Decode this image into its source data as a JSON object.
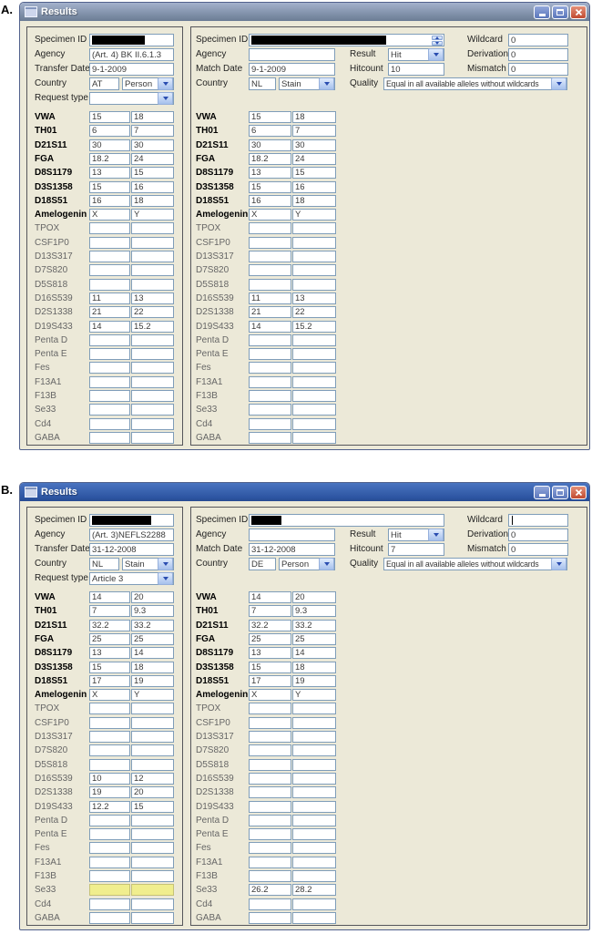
{
  "colors": {
    "titlebar_a": "#76879f",
    "titlebar_b": "#2d55a2",
    "close_button_red": "#c14a31",
    "dialog_background": "#ece9d8",
    "field_border": "#7f9db9",
    "highlight_yellow": "#f0ee8e",
    "redaction_black": "#000000"
  },
  "windows": [
    {
      "figure_label": "A.",
      "title": "Results",
      "left": {
        "specimen_label": "Specimen ID",
        "agency_label": "Agency",
        "agency_value": "(Art. 4) BK II.6.1.3",
        "transfer_label": "Transfer Date",
        "transfer_value": "9-1-2009",
        "country_label": "Country",
        "country_code": "AT",
        "country_type": "Person",
        "request_label": "Request type",
        "request_value": "",
        "loci": [
          {
            "n": "VWA",
            "a": "15",
            "b": "18",
            "bold": true
          },
          {
            "n": "TH01",
            "a": "6",
            "b": "7",
            "bold": true
          },
          {
            "n": "D21S11",
            "a": "30",
            "b": "30",
            "bold": true
          },
          {
            "n": "FGA",
            "a": "18.2",
            "b": "24",
            "bold": true
          },
          {
            "n": "D8S1179",
            "a": "13",
            "b": "15",
            "bold": true
          },
          {
            "n": "D3S1358",
            "a": "15",
            "b": "16",
            "bold": true
          },
          {
            "n": "D18S51",
            "a": "16",
            "b": "18",
            "bold": true
          },
          {
            "n": "Amelogenin",
            "a": "X",
            "b": "Y",
            "bold": true
          },
          {
            "n": "TPOX",
            "a": "",
            "b": ""
          },
          {
            "n": "CSF1P0",
            "a": "",
            "b": ""
          },
          {
            "n": "D13S317",
            "a": "",
            "b": ""
          },
          {
            "n": "D7S820",
            "a": "",
            "b": ""
          },
          {
            "n": "D5S818",
            "a": "",
            "b": ""
          },
          {
            "n": "D16S539",
            "a": "11",
            "b": "13"
          },
          {
            "n": "D2S1338",
            "a": "21",
            "b": "22"
          },
          {
            "n": "D19S433",
            "a": "14",
            "b": "15.2"
          },
          {
            "n": "Penta D",
            "a": "",
            "b": ""
          },
          {
            "n": "Penta E",
            "a": "",
            "b": ""
          },
          {
            "n": "Fes",
            "a": "",
            "b": ""
          },
          {
            "n": "F13A1",
            "a": "",
            "b": ""
          },
          {
            "n": "F13B",
            "a": "",
            "b": ""
          },
          {
            "n": "Se33",
            "a": "",
            "b": ""
          },
          {
            "n": "Cd4",
            "a": "",
            "b": ""
          },
          {
            "n": "GABA",
            "a": "",
            "b": ""
          }
        ]
      },
      "right": {
        "specimen_label": "Specimen ID",
        "agency_label": "Agency",
        "agency_value": "",
        "match_label": "Match Date",
        "match_value": "9-1-2009",
        "country_label": "Country",
        "country_code": "NL",
        "country_type": "Stain",
        "result_label": "Result",
        "result_value": "Hit",
        "hitcount_label": "Hitcount",
        "hitcount_value": "10",
        "quality_label": "Quality",
        "quality_value": "Equal in all available alleles without wildcards",
        "wildcard_label": "Wildcard",
        "wildcard_value": "0",
        "derivation_label": "Derivation",
        "derivation_value": "0",
        "mismatch_label": "Mismatch",
        "mismatch_value": "0",
        "loci": [
          {
            "n": "VWA",
            "a": "15",
            "b": "18",
            "bold": true
          },
          {
            "n": "TH01",
            "a": "6",
            "b": "7",
            "bold": true
          },
          {
            "n": "D21S11",
            "a": "30",
            "b": "30",
            "bold": true
          },
          {
            "n": "FGA",
            "a": "18.2",
            "b": "24",
            "bold": true
          },
          {
            "n": "D8S1179",
            "a": "13",
            "b": "15",
            "bold": true
          },
          {
            "n": "D3S1358",
            "a": "15",
            "b": "16",
            "bold": true
          },
          {
            "n": "D18S51",
            "a": "16",
            "b": "18",
            "bold": true
          },
          {
            "n": "Amelogenin",
            "a": "X",
            "b": "Y",
            "bold": true
          },
          {
            "n": "TPOX",
            "a": "",
            "b": ""
          },
          {
            "n": "CSF1P0",
            "a": "",
            "b": ""
          },
          {
            "n": "D13S317",
            "a": "",
            "b": ""
          },
          {
            "n": "D7S820",
            "a": "",
            "b": ""
          },
          {
            "n": "D5S818",
            "a": "",
            "b": ""
          },
          {
            "n": "D16S539",
            "a": "11",
            "b": "13"
          },
          {
            "n": "D2S1338",
            "a": "21",
            "b": "22"
          },
          {
            "n": "D19S433",
            "a": "14",
            "b": "15.2"
          },
          {
            "n": "Penta D",
            "a": "",
            "b": ""
          },
          {
            "n": "Penta E",
            "a": "",
            "b": ""
          },
          {
            "n": "Fes",
            "a": "",
            "b": ""
          },
          {
            "n": "F13A1",
            "a": "",
            "b": ""
          },
          {
            "n": "F13B",
            "a": "",
            "b": ""
          },
          {
            "n": "Se33",
            "a": "",
            "b": ""
          },
          {
            "n": "Cd4",
            "a": "",
            "b": ""
          },
          {
            "n": "GABA",
            "a": "",
            "b": ""
          }
        ]
      }
    },
    {
      "figure_label": "B.",
      "title": "Results",
      "left": {
        "specimen_label": "Specimen ID",
        "agency_label": "Agency",
        "agency_value": "(Art. 3)NEFLS2288",
        "transfer_label": "Transfer Date",
        "transfer_value": "31-12-2008",
        "country_label": "Country",
        "country_code": "NL",
        "country_type": "Stain",
        "request_label": "Request type",
        "request_value": "Article 3",
        "loci": [
          {
            "n": "VWA",
            "a": "14",
            "b": "20",
            "bold": true
          },
          {
            "n": "TH01",
            "a": "7",
            "b": "9.3",
            "bold": true
          },
          {
            "n": "D21S11",
            "a": "32.2",
            "b": "33.2",
            "bold": true
          },
          {
            "n": "FGA",
            "a": "25",
            "b": "25",
            "bold": true
          },
          {
            "n": "D8S1179",
            "a": "13",
            "b": "14",
            "bold": true
          },
          {
            "n": "D3S1358",
            "a": "15",
            "b": "18",
            "bold": true
          },
          {
            "n": "D18S51",
            "a": "17",
            "b": "19",
            "bold": true
          },
          {
            "n": "Amelogenin",
            "a": "X",
            "b": "Y",
            "bold": true
          },
          {
            "n": "TPOX",
            "a": "",
            "b": ""
          },
          {
            "n": "CSF1P0",
            "a": "",
            "b": ""
          },
          {
            "n": "D13S317",
            "a": "",
            "b": ""
          },
          {
            "n": "D7S820",
            "a": "",
            "b": ""
          },
          {
            "n": "D5S818",
            "a": "",
            "b": ""
          },
          {
            "n": "D16S539",
            "a": "10",
            "b": "12"
          },
          {
            "n": "D2S1338",
            "a": "19",
            "b": "20"
          },
          {
            "n": "D19S433",
            "a": "12.2",
            "b": "15"
          },
          {
            "n": "Penta D",
            "a": "",
            "b": ""
          },
          {
            "n": "Penta E",
            "a": "",
            "b": ""
          },
          {
            "n": "Fes",
            "a": "",
            "b": ""
          },
          {
            "n": "F13A1",
            "a": "",
            "b": ""
          },
          {
            "n": "F13B",
            "a": "",
            "b": ""
          },
          {
            "n": "Se33",
            "a": "",
            "b": "",
            "hl": true
          },
          {
            "n": "Cd4",
            "a": "",
            "b": ""
          },
          {
            "n": "GABA",
            "a": "",
            "b": ""
          }
        ]
      },
      "right": {
        "specimen_label": "Specimen ID",
        "agency_label": "Agency",
        "agency_value": "",
        "match_label": "Match Date",
        "match_value": "31-12-2008",
        "country_label": "Country",
        "country_code": "DE",
        "country_type": "Person",
        "result_label": "Result",
        "result_value": "Hit",
        "hitcount_label": "Hitcount",
        "hitcount_value": "7",
        "quality_label": "Quality",
        "quality_value": "Equal in all available alleles without wildcards",
        "wildcard_label": "Wildcard",
        "wildcard_value": "",
        "derivation_label": "Derivation",
        "derivation_value": "0",
        "mismatch_label": "Mismatch",
        "mismatch_value": "0",
        "loci": [
          {
            "n": "VWA",
            "a": "14",
            "b": "20",
            "bold": true
          },
          {
            "n": "TH01",
            "a": "7",
            "b": "9.3",
            "bold": true
          },
          {
            "n": "D21S11",
            "a": "32.2",
            "b": "33.2",
            "bold": true
          },
          {
            "n": "FGA",
            "a": "25",
            "b": "25",
            "bold": true
          },
          {
            "n": "D8S1179",
            "a": "13",
            "b": "14",
            "bold": true
          },
          {
            "n": "D3S1358",
            "a": "15",
            "b": "18",
            "bold": true
          },
          {
            "n": "D18S51",
            "a": "17",
            "b": "19",
            "bold": true
          },
          {
            "n": "Amelogenin",
            "a": "X",
            "b": "Y",
            "bold": true
          },
          {
            "n": "TPOX",
            "a": "",
            "b": ""
          },
          {
            "n": "CSF1P0",
            "a": "",
            "b": ""
          },
          {
            "n": "D13S317",
            "a": "",
            "b": ""
          },
          {
            "n": "D7S820",
            "a": "",
            "b": ""
          },
          {
            "n": "D5S818",
            "a": "",
            "b": ""
          },
          {
            "n": "D16S539",
            "a": "",
            "b": ""
          },
          {
            "n": "D2S1338",
            "a": "",
            "b": ""
          },
          {
            "n": "D19S433",
            "a": "",
            "b": ""
          },
          {
            "n": "Penta D",
            "a": "",
            "b": ""
          },
          {
            "n": "Penta E",
            "a": "",
            "b": ""
          },
          {
            "n": "Fes",
            "a": "",
            "b": ""
          },
          {
            "n": "F13A1",
            "a": "",
            "b": ""
          },
          {
            "n": "F13B",
            "a": "",
            "b": ""
          },
          {
            "n": "Se33",
            "a": "26.2",
            "b": "28.2"
          },
          {
            "n": "Cd4",
            "a": "",
            "b": ""
          },
          {
            "n": "GABA",
            "a": "",
            "b": ""
          }
        ]
      }
    }
  ]
}
